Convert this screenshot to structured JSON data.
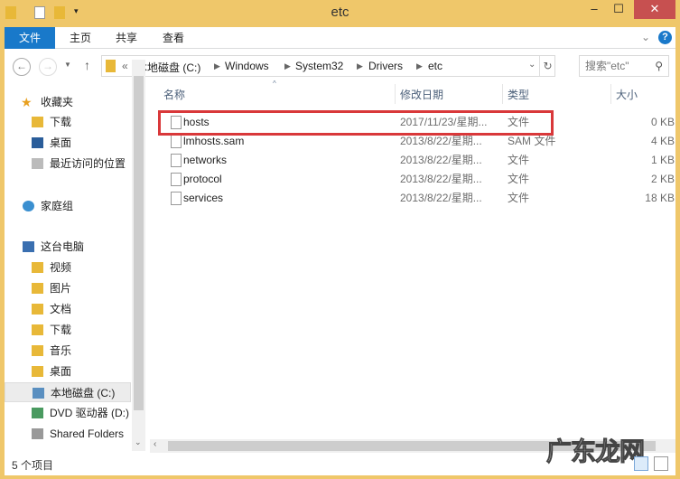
{
  "window": {
    "title": "etc",
    "minimize": "‒",
    "maximize": "☐",
    "close": "✕"
  },
  "ribbon": {
    "tabs": [
      "文件",
      "主页",
      "共享",
      "查看"
    ],
    "expand": "⌄",
    "help": "?"
  },
  "address": {
    "overflow": "«",
    "crumbs": [
      "本地磁盘 (C:)",
      "Windows",
      "System32",
      "Drivers",
      "etc"
    ],
    "search_placeholder": "搜索\"etc\""
  },
  "sidebar": {
    "groups": [
      {
        "label": "收藏夹",
        "items": [
          "下载",
          "桌面",
          "最近访问的位置"
        ]
      },
      {
        "label": "家庭组",
        "items": []
      },
      {
        "label": "这台电脑",
        "items": [
          "视频",
          "图片",
          "文档",
          "下载",
          "音乐",
          "桌面",
          "本地磁盘 (C:)",
          "DVD 驱动器 (D:)",
          "Shared Folders"
        ]
      }
    ]
  },
  "columns": [
    "名称",
    "修改日期",
    "类型",
    "大小"
  ],
  "files": [
    {
      "name": "hosts",
      "date": "2017/11/23/星期...",
      "type": "文件",
      "size": "0 KB",
      "highlighted": true
    },
    {
      "name": "lmhosts.sam",
      "date": "2013/8/22/星期...",
      "type": "SAM 文件",
      "size": "4 KB"
    },
    {
      "name": "networks",
      "date": "2013/8/22/星期...",
      "type": "文件",
      "size": "1 KB"
    },
    {
      "name": "protocol",
      "date": "2013/8/22/星期...",
      "type": "文件",
      "size": "2 KB"
    },
    {
      "name": "services",
      "date": "2013/8/22/星期...",
      "type": "文件",
      "size": "18 KB"
    }
  ],
  "status": {
    "count": "5 个项目"
  },
  "watermark": "广东龙网",
  "colors": {
    "frame": "#efc76a",
    "file_tab": "#1979ca",
    "highlight": "#d9383a",
    "close": "#c75050"
  }
}
